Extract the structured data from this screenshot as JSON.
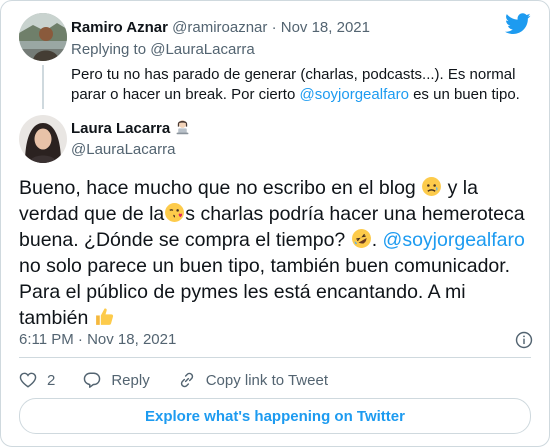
{
  "parent_tweet": {
    "name": "Ramiro Aznar",
    "handle": "@ramiroaznar",
    "separator": "·",
    "date": "Nov 18, 2021",
    "replying_prefix": "Replying to",
    "replying_handle": "@LauraLacarra",
    "text_before_link": "Pero tu no has parado de generar (charlas, podcasts...). Es normal parar o hacer un break. Por cierto",
    "link": "@soyjorgealfaro",
    "text_after_link": "es un buen tipo."
  },
  "main_tweet": {
    "name": "Laura Lacarra",
    "handle": "@LauraLacarra",
    "text_1": "Bueno, hace mucho que no escribo en el blog",
    "text_2": "y la verdad que de la",
    "text_3": "s charlas podría hacer una hemeroteca buena. ¿Dónde se compra el tiempo?",
    "link": "@soyjorgealfaro",
    "text_4": "no solo parece un buen tipo, también buen comunicador. Para el público de pymes les está encantando. A mi también",
    "timestamp": "6:11 PM · Nov 18, 2021"
  },
  "actions": {
    "like_count": "2",
    "reply_label": "Reply",
    "copy_link_label": "Copy link to Tweet"
  },
  "explore_label": "Explore what's happening on Twitter",
  "colors": {
    "accent": "#1d9bf0",
    "muted": "#536471",
    "border": "#cfd9de"
  },
  "icons": [
    "twitter-bird-icon",
    "info-icon",
    "heart-icon",
    "reply-bubble-icon",
    "link-icon",
    "technologist-emoji",
    "sad-relieved-emoji",
    "kiss-emoji",
    "rofl-emoji",
    "thumbs-up-emoji"
  ]
}
